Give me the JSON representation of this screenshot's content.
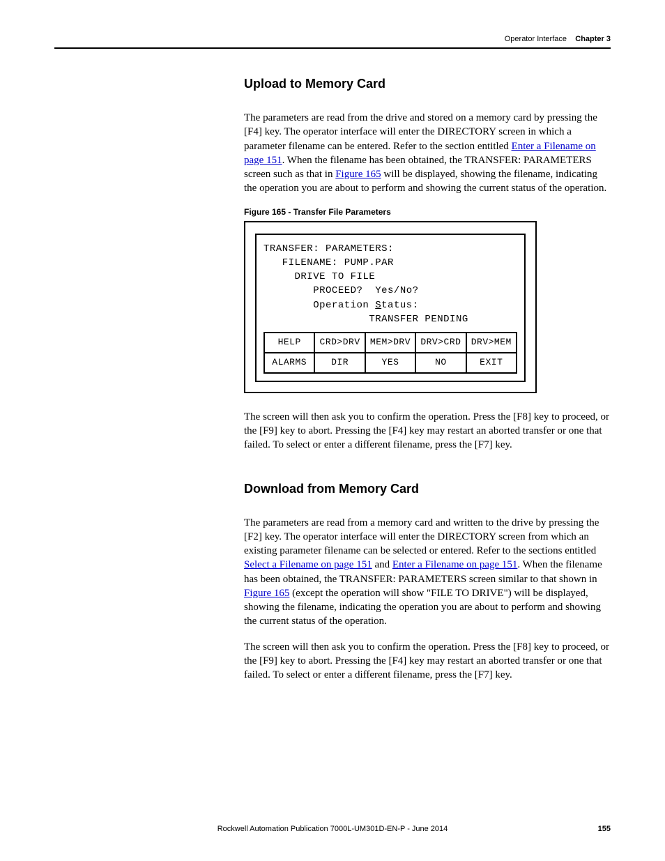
{
  "header": {
    "section": "Operator Interface",
    "chapter": "Chapter 3"
  },
  "upload": {
    "heading": "Upload to Memory Card",
    "p1a": "The parameters are read from the drive and stored on a memory card by pressing the [F4] key. The operator interface will enter the DIRECTORY screen in which a parameter filename can be entered. Refer to the section entitled ",
    "link1": "Enter a Filename on page 151",
    "p1b": ". When the filename has been obtained, the TRANSFER: PARAMETERS screen such as that in ",
    "link2": "Figure 165",
    "p1c": " will be displayed, showing the filename, indicating the operation you are about to perform and showing the current status of the operation.",
    "p2": "The screen will then ask you to confirm the operation. Press the [F8] key to proceed, or the [F9] key to abort. Pressing the [F4] key may restart an aborted transfer or one that failed. To select or enter a different filename, press the [F7] key."
  },
  "figure": {
    "caption": "Figure 165 - Transfer File Parameters",
    "lines": {
      "l1": "TRANSFER: PARAMETERS:",
      "l2": "   FILENAME: PUMP.PAR",
      "l3": "     DRIVE TO FILE",
      "l4": "        PROCEED?  Yes/No?",
      "l5a": "        Operation ",
      "l5b_pre": "S",
      "l5b": "tatus:",
      "l6": "                 TRANSFER PENDING"
    },
    "softkeys": {
      "row1": [
        "HELP",
        "CRD>DRV",
        "MEM>DRV",
        "DRV>CRD",
        "DRV>MEM"
      ],
      "row2": [
        "ALARMS",
        "DIR",
        "YES",
        "NO",
        "EXIT"
      ]
    }
  },
  "download": {
    "heading": "Download from Memory Card",
    "p1a": "The parameters are read from a memory card and written to the drive by pressing the [F2] key. The operator interface will enter the DIRECTORY screen from which an existing parameter filename can be selected or entered. Refer to the sections entitled ",
    "link1": "Select a Filename on page 151",
    "p1b": " and ",
    "link2": "Enter a Filename on page 151",
    "p1c": ".  When the filename has been obtained, the TRANSFER: PARAMETERS screen similar to that shown in ",
    "link3": "Figure 165",
    "p1d": " (except the operation will show \"FILE TO DRIVE\") will be displayed, showing the filename, indicating the operation you are about to perform and showing the current status of the operation.",
    "p2": "The screen will then ask you to confirm the operation. Press the [F8] key to proceed, or the [F9] key to abort. Pressing the [F4] key may restart an aborted transfer or one that failed. To select or enter a different filename, press the [F7] key."
  },
  "footer": {
    "pub": "Rockwell Automation Publication 7000L-UM301D-EN-P - June 2014",
    "page": "155"
  }
}
